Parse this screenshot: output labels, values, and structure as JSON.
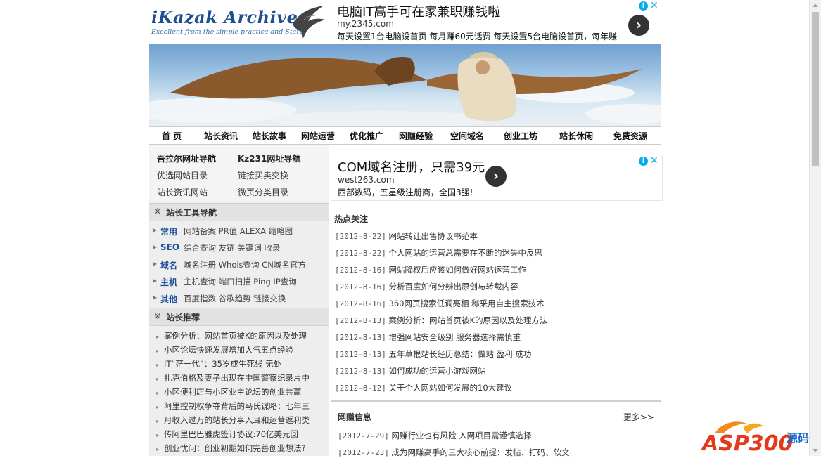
{
  "logo": {
    "title": "iKazak Archives",
    "slogan": "Excellent from the simple practica and Start!"
  },
  "ads": {
    "top": {
      "title": "电脑IT高手可在家兼职赚钱啦",
      "url": "my.2345.com",
      "desc": "每天设置1台电脑设首页 每月赚60元话费 每天设置5台电脑设首页，每年赚"
    },
    "mid": {
      "title": "COM域名注册，只需39元",
      "url": "west263.com",
      "desc": "西部数码，五星级注册商，全国3强!"
    },
    "go_symbol": "›",
    "info_symbol": "i",
    "close_symbol": "✕"
  },
  "nav": [
    "首 页",
    "站长资讯",
    "站长故事",
    "网站运营",
    "优化推广",
    "网赚经验",
    "空间域名",
    "创业工坊",
    "站长休闲",
    "免费资源"
  ],
  "left": {
    "sites": [
      {
        "label": "吾拉尔网址导航",
        "bold": true
      },
      {
        "label": "Kz231网址导航",
        "bold": true
      },
      {
        "label": "优选网站目录",
        "bold": false
      },
      {
        "label": "链接买卖交换",
        "bold": false
      },
      {
        "label": "站长资讯网站",
        "bold": false
      },
      {
        "label": "微页分类目录",
        "bold": false
      }
    ],
    "tools_head": "站长工具导航",
    "tools": [
      {
        "cat": "常用",
        "links": "网站备案 PR值 ALEXA 缩略图"
      },
      {
        "cat": "SEO",
        "links": "综合查询 友链 关键词 收录"
      },
      {
        "cat": "域名",
        "links": "域名注册 Whois查询 CN域名官方"
      },
      {
        "cat": "主机",
        "links": "主机查询 端口扫描 Ping IP查询"
      },
      {
        "cat": "其他",
        "links": "百度指数 谷歌趋势 链接交换"
      }
    ],
    "rec_head": "站长推荐",
    "rec_mark": "※",
    "recs": [
      "案例分析：网站首页被K的原因以及处理",
      "小区论坛快速发展增加人气五点经验",
      "IT“茫一代”：35岁成生死线 无处",
      "扎克伯格及妻子出现在中国警察纪录片中",
      "小区便利店与小区业主论坛的创业共赢",
      "阿里控制权争夺背后的马氏谋略：七年三",
      "月收入过万的站长分享入耳和运营返利类",
      "传阿里巴巴雅虎签订协议:70亿美元回",
      "创业忧问：创业初期如何完善创业想法?"
    ]
  },
  "hot": {
    "head": "热点关注",
    "items": [
      {
        "date": "[2012-8-22]",
        "title": "网站转让出售协议书范本"
      },
      {
        "date": "[2012-8-22]",
        "title": "个人网站的运营总需要在不断的迷失中反思"
      },
      {
        "date": "[2012-8-16]",
        "title": "网站降权后应该如何做好网站运营工作"
      },
      {
        "date": "[2012-8-16]",
        "title": "分析百度如何分辨出原创与转载内容"
      },
      {
        "date": "[2012-8-16]",
        "title": "360网页搜索低调亮相 称采用自主搜索技术"
      },
      {
        "date": "[2012-8-13]",
        "title": "案例分析：网站首页被K的原因以及处理方法"
      },
      {
        "date": "[2012-8-13]",
        "title": "增强网站安全级别 服务器选择需慎重"
      },
      {
        "date": "[2012-8-13]",
        "title": "五年草根站长经历总结：做站 盈利 成功"
      },
      {
        "date": "[2012-8-13]",
        "title": "如何成功的运营小游戏网站"
      },
      {
        "date": "[2012-8-12]",
        "title": "关于个人网站如何发展的10大建议"
      }
    ]
  },
  "wangzhuan": {
    "head": "网赚信息",
    "more": "更多>>",
    "items": [
      {
        "date": "[2012-7-29]",
        "title": "网赚行业也有风险 入网项目需谨慎选择"
      },
      {
        "date": "[2012-7-23]",
        "title": "成为网赚高手的三大核心前提：发帖、打码、软文"
      }
    ]
  },
  "watermark": {
    "brand": "ASP300",
    "suffix": "源码"
  },
  "colors": {
    "nav_text": "#111111",
    "category_blue": "#1d4f9c",
    "ad_info": "#00aeef",
    "left_bg": "#eeeeee"
  }
}
